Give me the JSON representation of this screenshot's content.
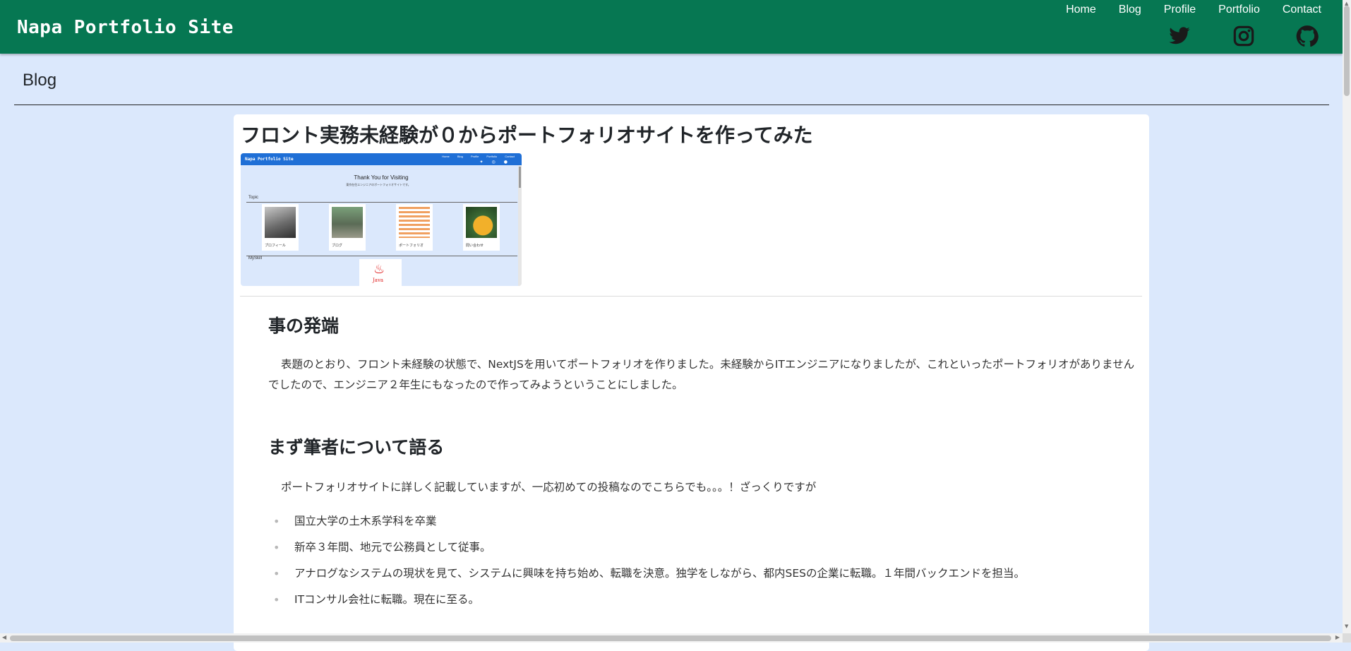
{
  "header": {
    "brand": "Napa Portfolio Site",
    "nav": [
      "Home",
      "Blog",
      "Profile",
      "Portfolio",
      "Contact"
    ],
    "social_icons": [
      "twitter-icon",
      "instagram-icon",
      "github-icon"
    ],
    "bg_color": "#067752"
  },
  "page": {
    "section_title": "Blog",
    "bg_color": "#dbe8fc"
  },
  "article": {
    "title": "フロント実務未経験が０からポートフォリオサイトを作ってみた",
    "thumbnail": {
      "brand": "Napa Portfolio Site",
      "nav": "Home Blog Profile Portfolio Contact",
      "thanks": "Thank You for Visiting",
      "subtitle": "東京在住エンジニアのポートフォリオサイトです。",
      "topic_label": "Topic",
      "cards": [
        "プロフィール",
        "ブログ",
        "ポートフォリオ",
        "問い合わせ"
      ],
      "skill_label": "MySkill",
      "java_label": "Java"
    },
    "sections": [
      {
        "heading": "事の発端",
        "paragraph": "表題のとおり、フロント未経験の状態で、NextJSを用いてポートフォリオを作りました。未経験からITエンジニアになりましたが、これといったポートフォリオがありませんでしたので、エンジニア２年生にもなったので作ってみようということにしました。"
      },
      {
        "heading": "まず筆者について語る",
        "paragraph": "ポートフォリオサイトに詳しく記載していますが、一応初めての投稿なのでこちらでも。。。！ざっくりですが",
        "bullets": [
          "国立大学の土木系学科を卒業",
          "新卒３年間、地元で公務員として従事。",
          "アナログなシステムの現状を見て、システムに興味を持ち始め、転職を決意。独学をしながら、都内SESの企業に転職。１年間バックエンドを担当。",
          "ITコンサル会社に転職。現在に至る。"
        ]
      }
    ]
  }
}
